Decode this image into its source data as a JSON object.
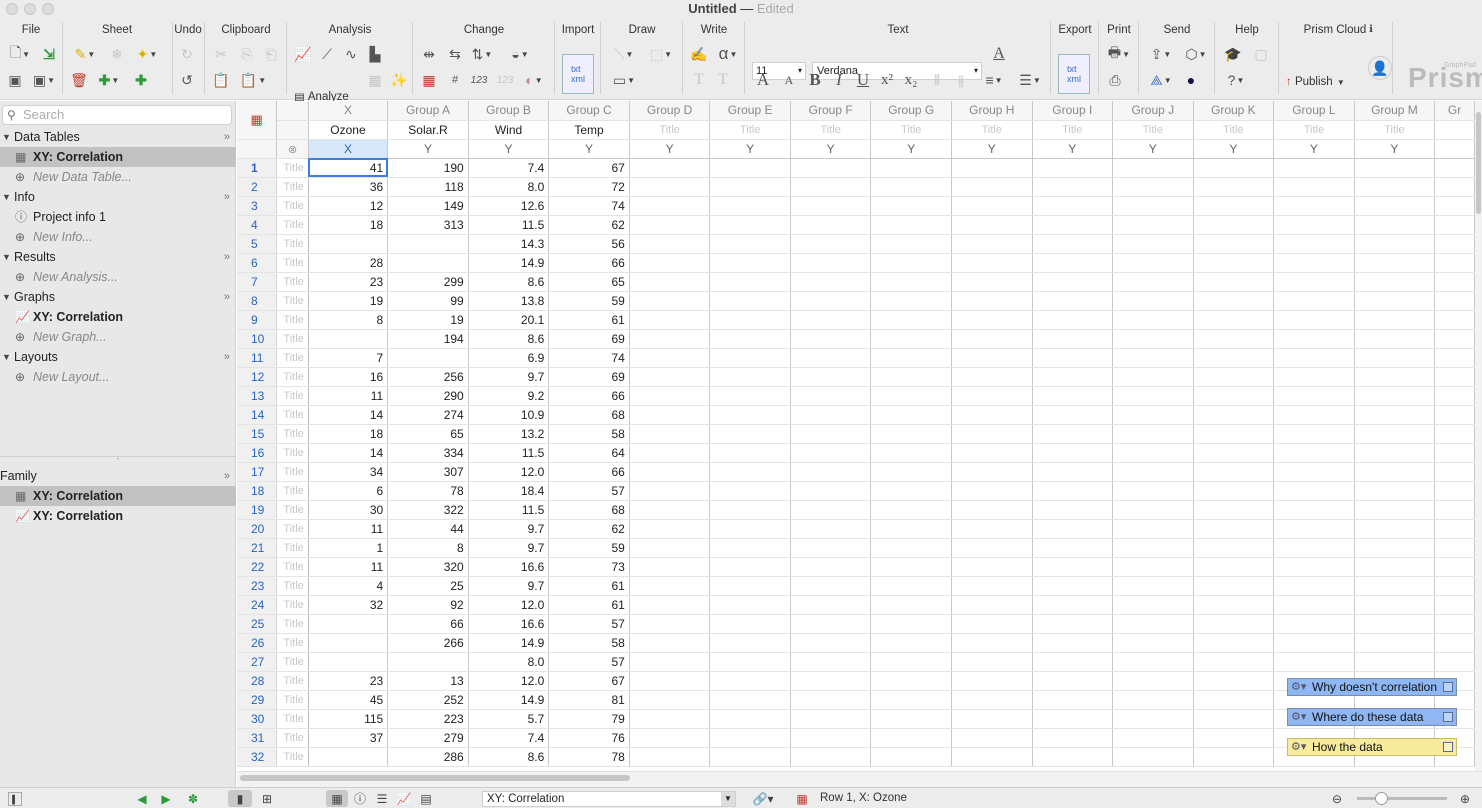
{
  "window": {
    "title": "Untitled",
    "dash": " — ",
    "subtitle": "Edited"
  },
  "toolbar": {
    "groups": [
      "File",
      "Sheet",
      "Undo",
      "Clipboard",
      "Analysis",
      "Change",
      "Import",
      "Draw",
      "Write",
      "Text",
      "Export",
      "Print",
      "Send",
      "Help",
      "Prism Cloud"
    ],
    "analyze_label": "Analyze",
    "font_size": "11",
    "font_name": "Verdana",
    "publish_label": "Publish",
    "logo_text": "Prism",
    "logo_small": "GraphPad"
  },
  "sidebar": {
    "search_placeholder": "Search",
    "sections": [
      {
        "label": "Data Tables",
        "items": [
          {
            "label": "XY: Correlation",
            "selected": true
          }
        ],
        "new_label": "New Data Table..."
      },
      {
        "label": "Info",
        "items": [
          {
            "label": "Project info 1"
          }
        ],
        "new_label": "New Info..."
      },
      {
        "label": "Results",
        "items": [],
        "new_label": "New Analysis..."
      },
      {
        "label": "Graphs",
        "items": [
          {
            "label": "XY: Correlation"
          }
        ],
        "new_label": "New Graph..."
      },
      {
        "label": "Layouts",
        "items": [],
        "new_label": "New Layout..."
      }
    ],
    "family": {
      "label": "Family",
      "items": [
        {
          "label": "XY: Correlation"
        },
        {
          "label": "XY: Correlation"
        }
      ]
    }
  },
  "table": {
    "group_headers": [
      "X",
      "Group A",
      "Group B",
      "Group C",
      "Group D",
      "Group E",
      "Group F",
      "Group G",
      "Group H",
      "Group I",
      "Group J",
      "Group K",
      "Group L",
      "Group M",
      "Gr"
    ],
    "titles": [
      "Ozone",
      "Solar.R",
      "Wind",
      "Temp",
      "Title",
      "Title",
      "Title",
      "Title",
      "Title",
      "Title",
      "Title",
      "Title",
      "Title",
      "Title"
    ],
    "sub_headers": [
      "X",
      "Y",
      "Y",
      "Y",
      "Y",
      "Y",
      "Y",
      "Y",
      "Y",
      "Y",
      "Y",
      "Y",
      "Y",
      "Y"
    ],
    "row_title_placeholder": "Title",
    "rows": [
      [
        "1",
        "41",
        "190",
        "7.4",
        "67"
      ],
      [
        "2",
        "36",
        "118",
        "8.0",
        "72"
      ],
      [
        "3",
        "12",
        "149",
        "12.6",
        "74"
      ],
      [
        "4",
        "18",
        "313",
        "11.5",
        "62"
      ],
      [
        "5",
        "",
        "",
        "14.3",
        "56"
      ],
      [
        "6",
        "28",
        "",
        "14.9",
        "66"
      ],
      [
        "7",
        "23",
        "299",
        "8.6",
        "65"
      ],
      [
        "8",
        "19",
        "99",
        "13.8",
        "59"
      ],
      [
        "9",
        "8",
        "19",
        "20.1",
        "61"
      ],
      [
        "10",
        "",
        "194",
        "8.6",
        "69"
      ],
      [
        "11",
        "7",
        "",
        "6.9",
        "74"
      ],
      [
        "12",
        "16",
        "256",
        "9.7",
        "69"
      ],
      [
        "13",
        "11",
        "290",
        "9.2",
        "66"
      ],
      [
        "14",
        "14",
        "274",
        "10.9",
        "68"
      ],
      [
        "15",
        "18",
        "65",
        "13.2",
        "58"
      ],
      [
        "16",
        "14",
        "334",
        "11.5",
        "64"
      ],
      [
        "17",
        "34",
        "307",
        "12.0",
        "66"
      ],
      [
        "18",
        "6",
        "78",
        "18.4",
        "57"
      ],
      [
        "19",
        "30",
        "322",
        "11.5",
        "68"
      ],
      [
        "20",
        "11",
        "44",
        "9.7",
        "62"
      ],
      [
        "21",
        "1",
        "8",
        "9.7",
        "59"
      ],
      [
        "22",
        "11",
        "320",
        "16.6",
        "73"
      ],
      [
        "23",
        "4",
        "25",
        "9.7",
        "61"
      ],
      [
        "24",
        "32",
        "92",
        "12.0",
        "61"
      ],
      [
        "25",
        "",
        "66",
        "16.6",
        "57"
      ],
      [
        "26",
        "",
        "266",
        "14.9",
        "58"
      ],
      [
        "27",
        "",
        "",
        "8.0",
        "57"
      ],
      [
        "28",
        "23",
        "13",
        "12.0",
        "67"
      ],
      [
        "29",
        "45",
        "252",
        "14.9",
        "81"
      ],
      [
        "30",
        "115",
        "223",
        "5.7",
        "79"
      ],
      [
        "31",
        "37",
        "279",
        "7.4",
        "76"
      ],
      [
        "32",
        "",
        "286",
        "8.6",
        "78"
      ]
    ]
  },
  "notes": [
    {
      "label": "Why doesn't correlation",
      "color": "blue"
    },
    {
      "label": "Where do these data",
      "color": "blue"
    },
    {
      "label": "How the data",
      "color": "yellow"
    }
  ],
  "statusbar": {
    "sheet": "XY: Correlation",
    "status": "Row 1, X: Ozone"
  }
}
